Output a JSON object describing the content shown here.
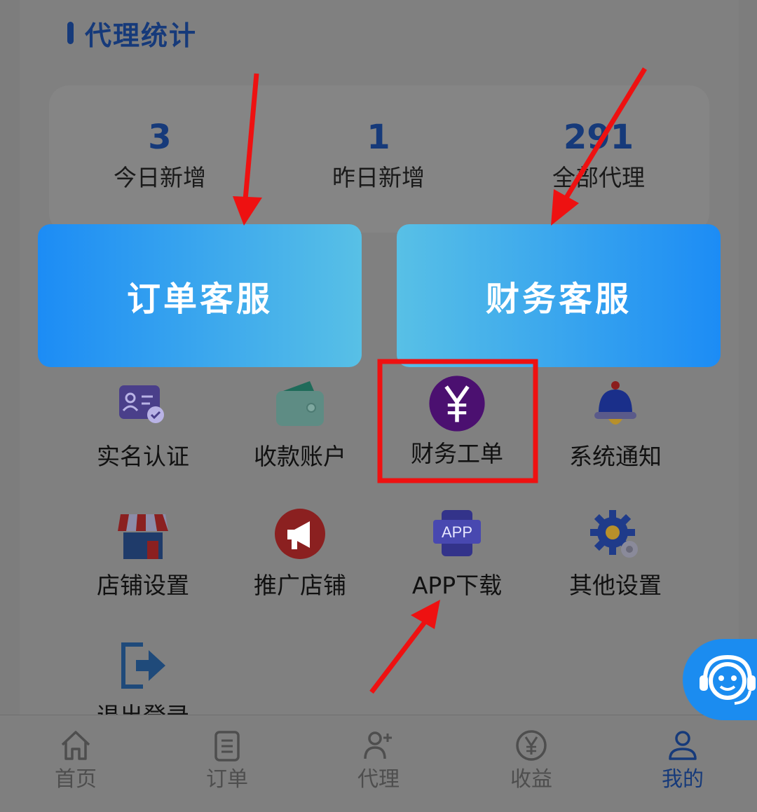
{
  "section": {
    "title": "代理统计"
  },
  "stats": [
    {
      "value": "3",
      "label": "今日新增"
    },
    {
      "value": "1",
      "label": "昨日新增"
    },
    {
      "value": "291",
      "label": "全部代理"
    }
  ],
  "service_buttons": {
    "order": "订单客服",
    "finance": "财务客服"
  },
  "menu": [
    {
      "label": "实名认证",
      "icon": "id-card-icon"
    },
    {
      "label": "收款账户",
      "icon": "wallet-icon"
    },
    {
      "label": "财务工单",
      "icon": "yuan-coin-icon"
    },
    {
      "label": "系统通知",
      "icon": "bell-icon"
    },
    {
      "label": "店铺设置",
      "icon": "storefront-icon"
    },
    {
      "label": "推广店铺",
      "icon": "megaphone-icon"
    },
    {
      "label": "APP下载",
      "icon": "app-download-icon",
      "icon_text": "APP"
    },
    {
      "label": "其他设置",
      "icon": "gear-icon"
    },
    {
      "label": "退出登录",
      "icon": "logout-icon"
    }
  ],
  "bottom_nav": [
    {
      "label": "首页",
      "icon": "home-icon"
    },
    {
      "label": "订单",
      "icon": "order-list-icon"
    },
    {
      "label": "代理",
      "icon": "add-user-icon"
    },
    {
      "label": "收益",
      "icon": "yuan-circle-icon"
    },
    {
      "label": "我的",
      "icon": "profile-icon",
      "active": true
    }
  ],
  "colors": {
    "accent_dark": "#163a7a",
    "button_blue": "#1c8cf5",
    "button_light": "#58c0e6",
    "annotation_red": "#ee1111"
  }
}
